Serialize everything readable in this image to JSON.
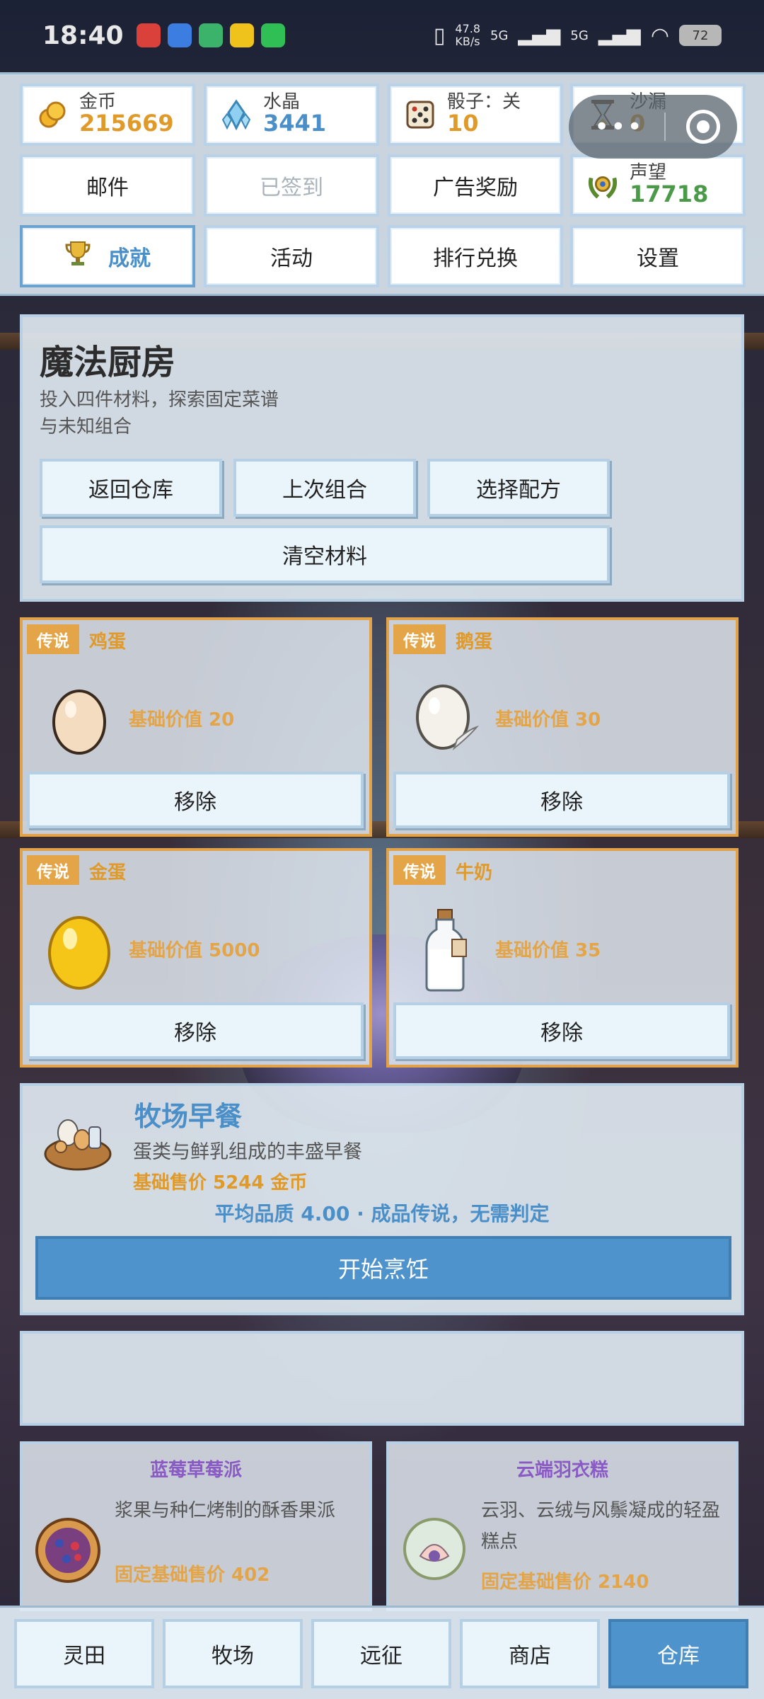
{
  "status_bar": {
    "time": "18:40",
    "net_speed": "47.8\nKB/s",
    "net_a": "5G",
    "net_b": "5G",
    "battery": "72"
  },
  "stats": {
    "gold": {
      "label": "金币",
      "value": "215669",
      "icon": "gold-coins-icon"
    },
    "crystal": {
      "label": "水晶",
      "value": "3441",
      "icon": "crystal-icon"
    },
    "dice": {
      "label": "骰子：关",
      "value": "10",
      "icon": "dice-icon"
    },
    "hourglass": {
      "label": "沙漏",
      "value": "0",
      "icon": "hourglass-icon"
    },
    "reputation": {
      "label": "声望",
      "value": "17718",
      "icon": "laurel-emblem-icon"
    }
  },
  "top_buttons": {
    "mail": "邮件",
    "signed": "已签到",
    "ad_reward": "广告奖励",
    "achievement": "成就",
    "activity": "活动",
    "rank_exchange": "排行兑换",
    "settings": "设置"
  },
  "kitchen": {
    "title": "魔法厨房",
    "description": "投入四件材料，探索固定菜谱与未知组合",
    "back": "返回仓库",
    "last_combo": "上次组合",
    "choose_recipe": "选择配方",
    "clear": "清空材料"
  },
  "ingredients": [
    {
      "tag": "传说",
      "name": "鸡蛋",
      "value": "基础价值 20",
      "remove": "移除",
      "icon": "chicken-egg-icon"
    },
    {
      "tag": "传说",
      "name": "鹅蛋",
      "value": "基础价值 30",
      "remove": "移除",
      "icon": "goose-egg-icon"
    },
    {
      "tag": "传说",
      "name": "金蛋",
      "value": "基础价值 5000",
      "remove": "移除",
      "icon": "golden-egg-icon"
    },
    {
      "tag": "传说",
      "name": "牛奶",
      "value": "基础价值 35",
      "remove": "移除",
      "icon": "milk-bottle-icon"
    }
  ],
  "result": {
    "title": "牧场早餐",
    "description": "蛋类与鲜乳组成的丰盛早餐",
    "price": "基础售价 5244 金币",
    "quality": "平均品质 4.00 · 成品传说，无需判定",
    "cook": "开始烹饪",
    "icon": "breakfast-basket-icon"
  },
  "recipes": [
    {
      "title": "蓝莓草莓派",
      "description": "浆果与种仁烤制的酥香果派",
      "price": "固定基础售价 402",
      "icon": "berry-pie-icon"
    },
    {
      "title": "云端羽衣糕",
      "description": "云羽、云绒与风鬃凝成的轻盈糕点",
      "price": "固定基础售价 2140",
      "icon": "cloud-cake-icon"
    }
  ],
  "nav": [
    "灵田",
    "牧场",
    "远征",
    "商店",
    "仓库"
  ],
  "nav_active": "仓库",
  "colors": {
    "accent": "#4e93cb",
    "gold": "#e09a2a",
    "legend": "#e3a548",
    "recipe_title": "#8a5bc4"
  }
}
